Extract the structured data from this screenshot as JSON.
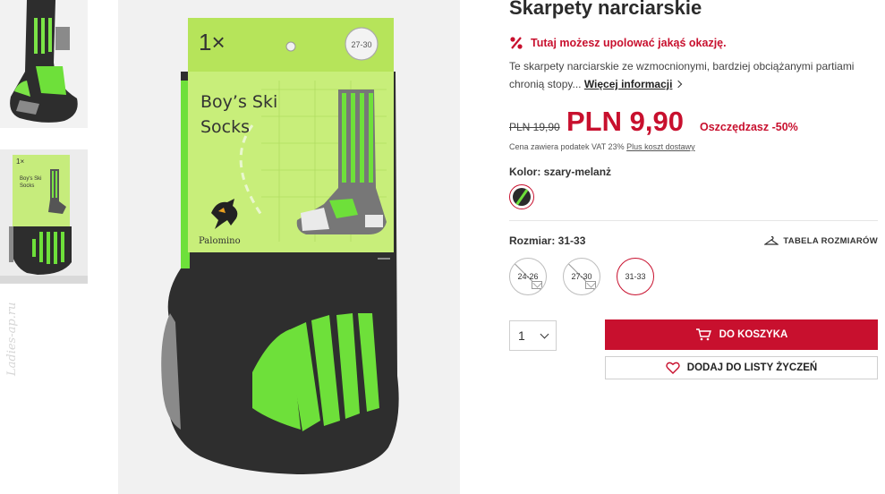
{
  "thumbnails": [
    {
      "name": "sock-side-view",
      "selected": false
    },
    {
      "name": "sock-pack-view",
      "selected": true
    }
  ],
  "watermark": "Ladies-ap.ru",
  "main_image": {
    "pack_count": "1×",
    "pack_size": "27-30",
    "pack_title_line1": "Boy’s Ski",
    "pack_title_line2": "Socks",
    "brand": "Palomino"
  },
  "product": {
    "title": "Skarpety narciarskie",
    "promo_text": "Tutaj możesz upolować jakąś okazję.",
    "description": "Te skarpety narciarskie ze wzmocnionymi, bardziej obciążanymi partiami chronią stopy...",
    "more_info": "Więcej informacji",
    "old_price": "PLN 19,90",
    "new_price": "PLN 9,90",
    "savings": "Oszczędzasz -50%",
    "vat_note": "Cena zawiera podatek VAT 23%",
    "shipping_link": "Plus koszt dostawy",
    "color_label": "Kolor: szary-melanż",
    "size_label": "Rozmiar: 31-33",
    "size_table": "TABELA ROZMIARÓW",
    "sizes": [
      {
        "label": "24-26",
        "available": false
      },
      {
        "label": "27-30",
        "available": false
      },
      {
        "label": "31-33",
        "available": true,
        "selected": true
      }
    ],
    "quantity": "1",
    "add_to_cart": "DO KOSZYKA",
    "add_to_wishlist": "DODAJ DO LISTY ŻYCZEŃ"
  },
  "colors": {
    "accent": "#c8102e",
    "sock_green": "#6ee03a",
    "sock_dark": "#2b2b2b"
  }
}
